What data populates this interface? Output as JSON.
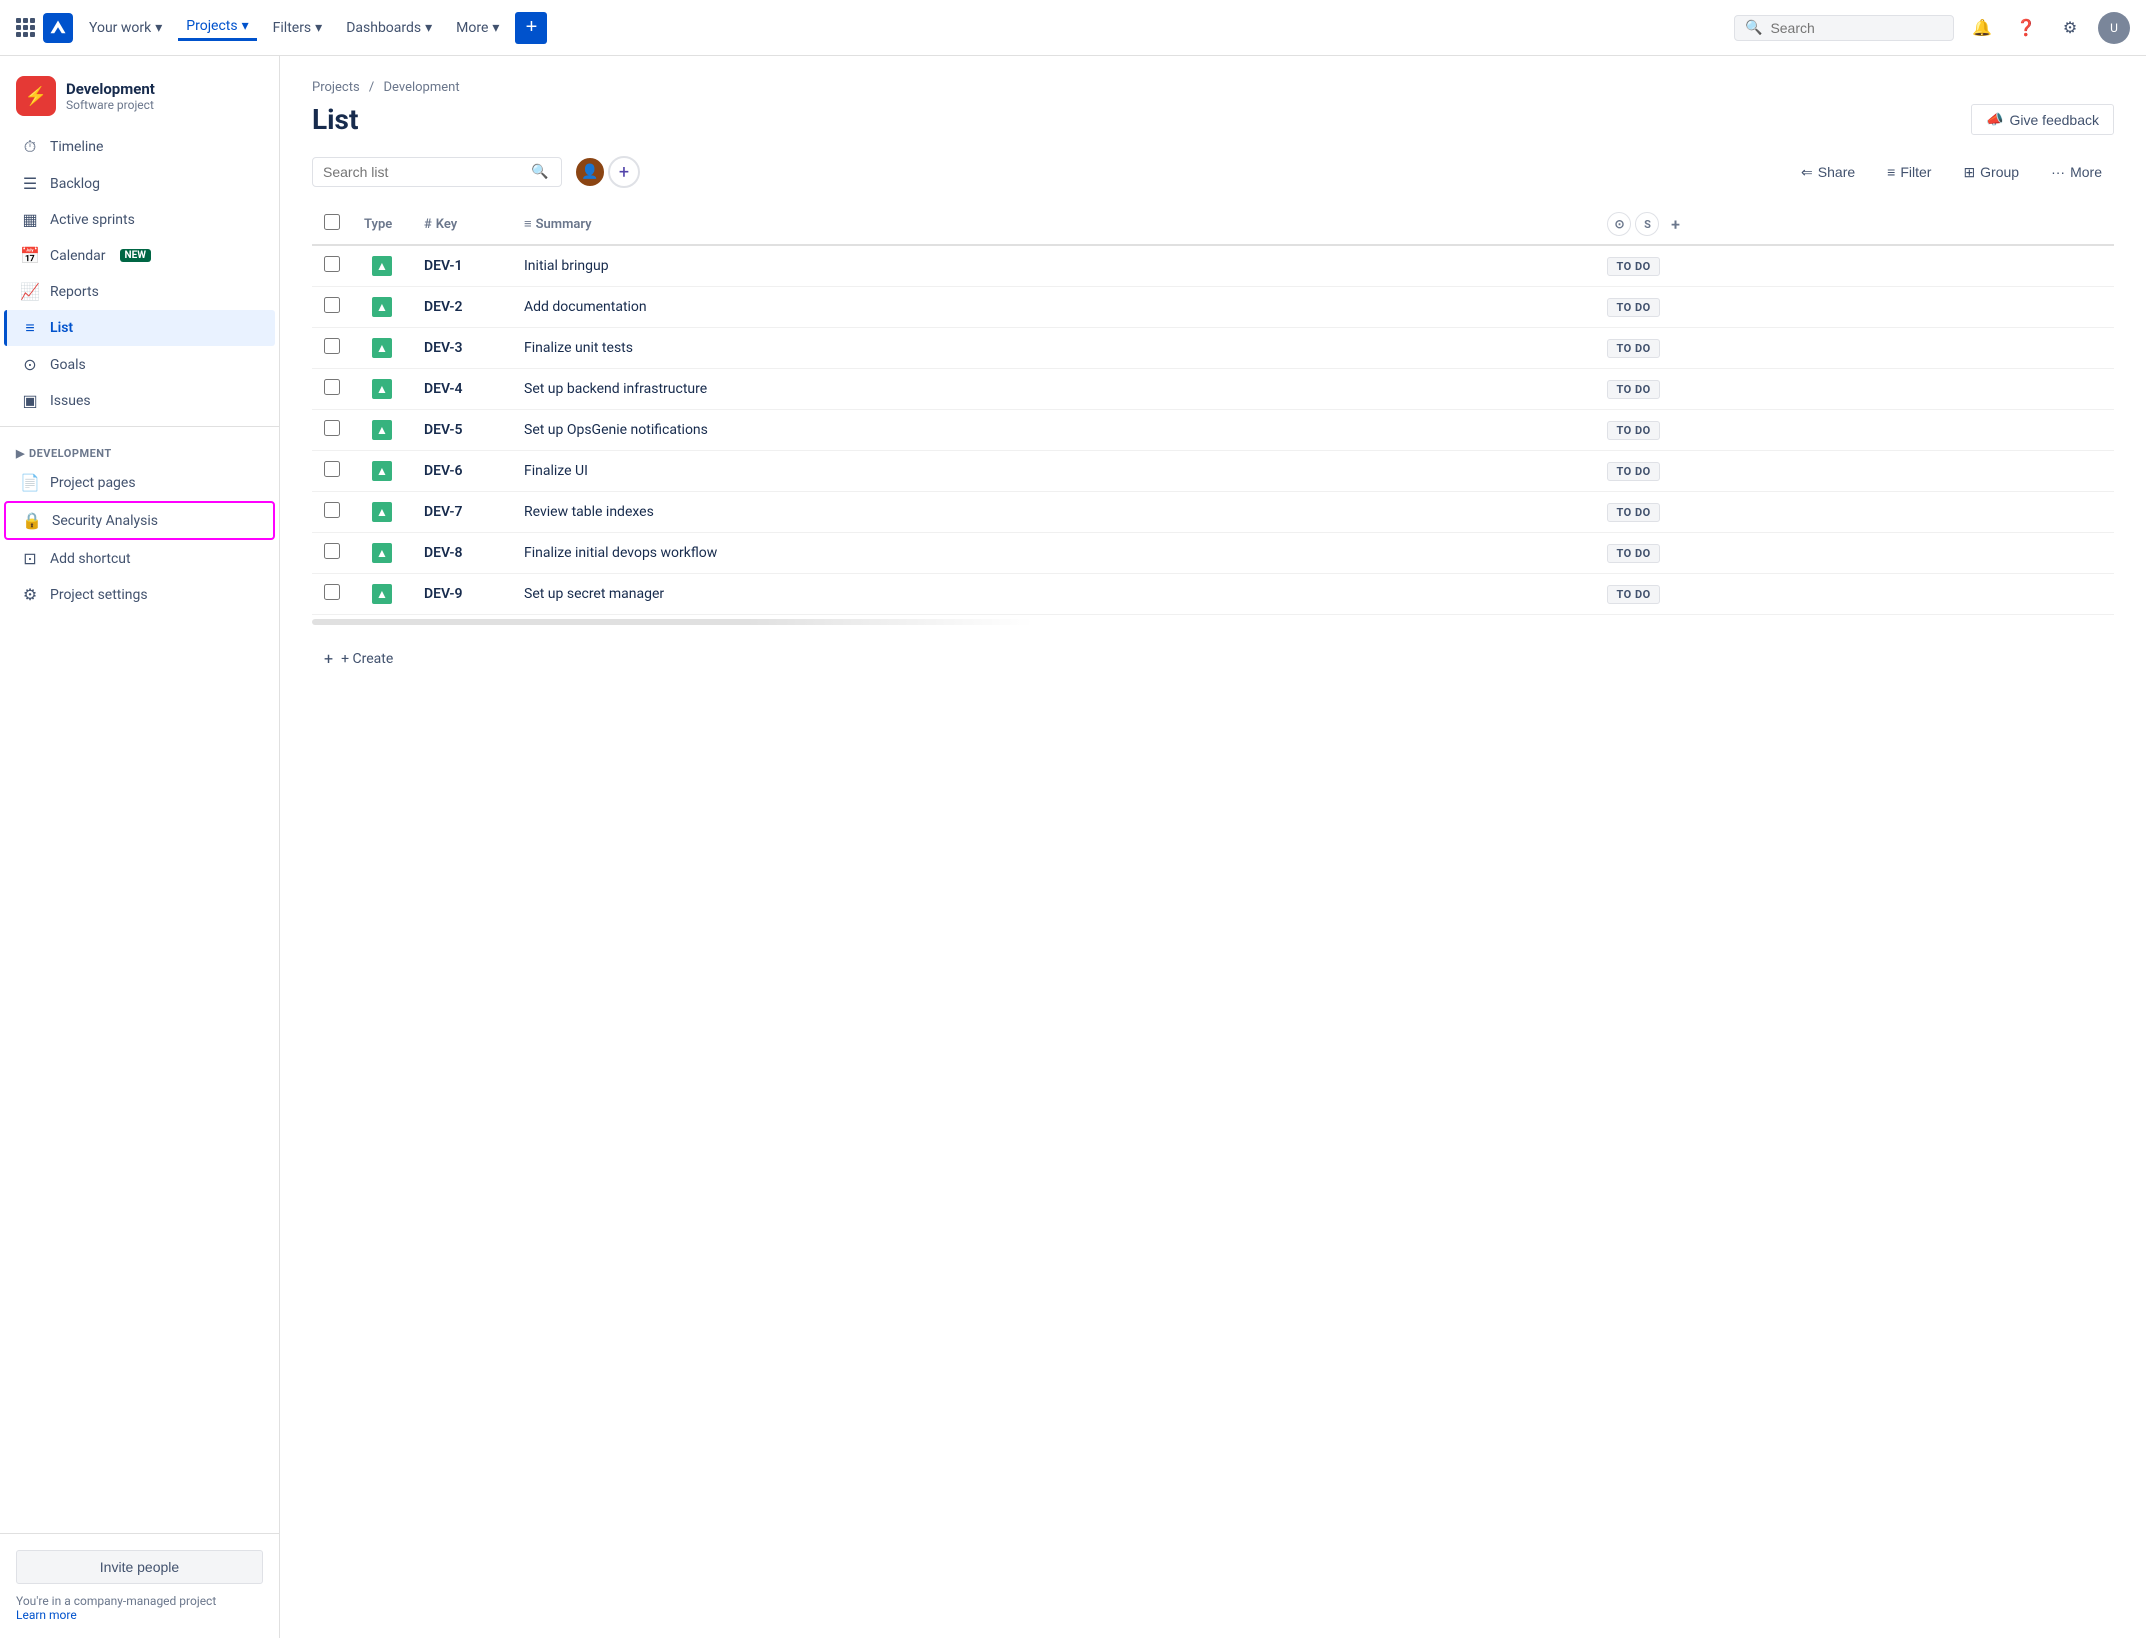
{
  "topNav": {
    "navItems": [
      {
        "label": "Your work",
        "hasDropdown": true,
        "active": false
      },
      {
        "label": "Projects",
        "hasDropdown": true,
        "active": true
      },
      {
        "label": "Filters",
        "hasDropdown": true,
        "active": false
      },
      {
        "label": "Dashboards",
        "hasDropdown": true,
        "active": false
      },
      {
        "label": "More",
        "hasDropdown": true,
        "active": false
      }
    ],
    "createLabel": "+",
    "searchPlaceholder": "Search"
  },
  "sidebar": {
    "projectName": "Development",
    "projectType": "Software project",
    "navItems": [
      {
        "id": "timeline",
        "label": "Timeline",
        "icon": "⏱"
      },
      {
        "id": "backlog",
        "label": "Backlog",
        "icon": "☰"
      },
      {
        "id": "active-sprints",
        "label": "Active sprints",
        "icon": "▦"
      },
      {
        "id": "calendar",
        "label": "Calendar",
        "icon": "📅",
        "badge": "NEW"
      },
      {
        "id": "reports",
        "label": "Reports",
        "icon": "📈"
      },
      {
        "id": "list",
        "label": "List",
        "icon": "≡",
        "active": true
      },
      {
        "id": "goals",
        "label": "Goals",
        "icon": "⊙"
      },
      {
        "id": "issues",
        "label": "Issues",
        "icon": "▣"
      }
    ],
    "developmentSection": "DEVELOPMENT",
    "devItems": [
      {
        "id": "project-pages",
        "label": "Project pages",
        "icon": "📄"
      },
      {
        "id": "security-analysis",
        "label": "Security Analysis",
        "icon": "🔒",
        "highlighted": true
      },
      {
        "id": "add-shortcut",
        "label": "Add shortcut",
        "icon": "⊡"
      },
      {
        "id": "project-settings",
        "label": "Project settings",
        "icon": "⚙"
      }
    ],
    "inviteBtn": "Invite people",
    "companyMsg": "You're in a company-managed project",
    "learnMore": "Learn more"
  },
  "main": {
    "breadcrumb": {
      "projects": "Projects",
      "separator": "/",
      "current": "Development"
    },
    "pageTitle": "List",
    "giveFeedback": "Give feedback",
    "searchListPlaceholder": "Search list",
    "toolbar": {
      "shareLabel": "Share",
      "filterLabel": "Filter",
      "groupLabel": "Group",
      "moreLabel": "More"
    },
    "tableHeaders": [
      {
        "key": "type",
        "label": "Type"
      },
      {
        "key": "key",
        "label": "Key",
        "icon": "#"
      },
      {
        "key": "summary",
        "label": "Summary",
        "icon": "≡"
      }
    ],
    "issues": [
      {
        "key": "DEV-1",
        "summary": "Initial bringup",
        "status": "TO DO"
      },
      {
        "key": "DEV-2",
        "summary": "Add documentation",
        "status": "TO DO"
      },
      {
        "key": "DEV-3",
        "summary": "Finalize unit tests",
        "status": "TO DO"
      },
      {
        "key": "DEV-4",
        "summary": "Set up backend infrastructure",
        "status": "TO DO"
      },
      {
        "key": "DEV-5",
        "summary": "Set up OpsGenie notifications",
        "status": "TO DO"
      },
      {
        "key": "DEV-6",
        "summary": "Finalize UI",
        "status": "TO DO"
      },
      {
        "key": "DEV-7",
        "summary": "Review table indexes",
        "status": "TO DO"
      },
      {
        "key": "DEV-8",
        "summary": "Finalize initial devops workflow",
        "status": "TO DO"
      },
      {
        "key": "DEV-9",
        "summary": "Set up secret manager",
        "status": "TO DO"
      }
    ],
    "createLabel": "+ Create"
  }
}
